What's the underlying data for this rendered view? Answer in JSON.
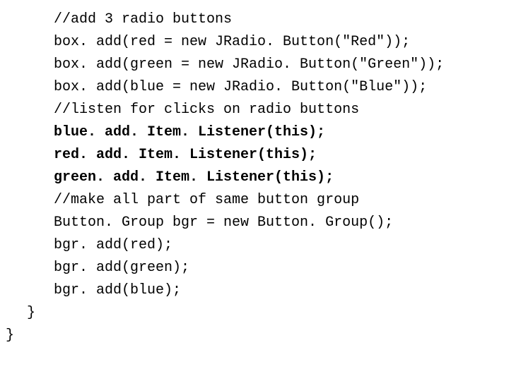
{
  "code": {
    "lines": [
      {
        "indent": 2,
        "bold": false,
        "text": "//add 3 radio buttons"
      },
      {
        "indent": 2,
        "bold": false,
        "text": "box. add(red = new JRadio. Button(\"Red\"));"
      },
      {
        "indent": 2,
        "bold": false,
        "text": "box. add(green = new JRadio. Button(\"Green\"));"
      },
      {
        "indent": 2,
        "bold": false,
        "text": "box. add(blue = new JRadio. Button(\"Blue\"));"
      },
      {
        "indent": 2,
        "bold": false,
        "text": "//listen for clicks on radio buttons"
      },
      {
        "indent": 2,
        "bold": true,
        "text": "blue. add. Item. Listener(this);"
      },
      {
        "indent": 2,
        "bold": true,
        "text": "red. add. Item. Listener(this);"
      },
      {
        "indent": 2,
        "bold": true,
        "text": "green. add. Item. Listener(this);"
      },
      {
        "indent": 2,
        "bold": false,
        "text": "//make all part of same button group"
      },
      {
        "indent": 2,
        "bold": false,
        "text": "Button. Group bgr = new Button. Group();"
      },
      {
        "indent": 2,
        "bold": false,
        "text": "bgr. add(red);"
      },
      {
        "indent": 2,
        "bold": false,
        "text": "bgr. add(green);"
      },
      {
        "indent": 2,
        "bold": false,
        "text": "bgr. add(blue);"
      },
      {
        "indent": 1,
        "bold": false,
        "text": "}"
      },
      {
        "indent": 0,
        "bold": false,
        "text": "}"
      }
    ]
  }
}
